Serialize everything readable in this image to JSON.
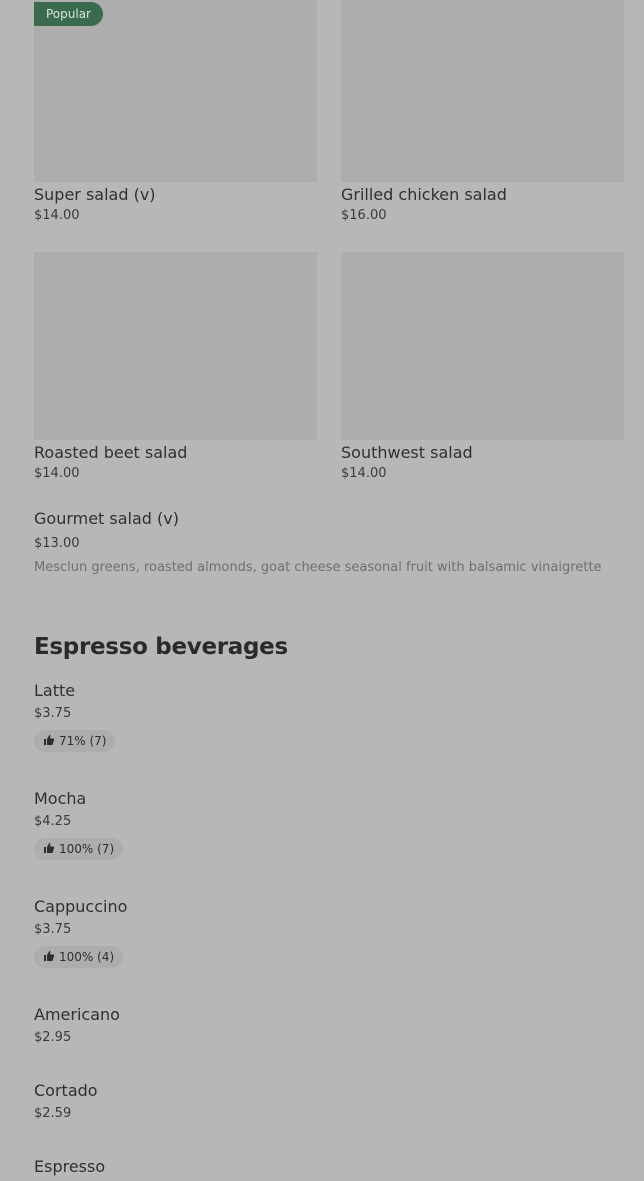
{
  "salads": [
    {
      "name": "Super salad (v)",
      "price": "$14.00",
      "badge": "Popular"
    },
    {
      "name": "Grilled chicken salad",
      "price": "$16.00"
    },
    {
      "name": "Roasted beet salad",
      "price": "$14.00"
    },
    {
      "name": "Southwest salad",
      "price": "$14.00"
    }
  ],
  "gourmet": {
    "name": "Gourmet salad (v)",
    "price": "$13.00",
    "description": "Mesclun greens, roasted almonds, goat cheese seasonal fruit with balsamic vinaigrette"
  },
  "espresso_section": {
    "title": "Espresso beverages",
    "items": [
      {
        "name": "Latte",
        "price": "$3.75",
        "rating": "71% (7)"
      },
      {
        "name": "Mocha",
        "price": "$4.25",
        "rating": "100% (7)"
      },
      {
        "name": "Cappuccino",
        "price": "$3.75",
        "rating": "100% (4)"
      },
      {
        "name": "Americano",
        "price": "$2.95"
      },
      {
        "name": "Cortado",
        "price": "$2.59"
      },
      {
        "name": "Espresso"
      }
    ]
  },
  "icons": {
    "rating": "thumbs-up-icon"
  },
  "colors": {
    "background": "#b7b7b7",
    "image_placeholder": "#adadad",
    "badge": "#3a6b4f"
  }
}
